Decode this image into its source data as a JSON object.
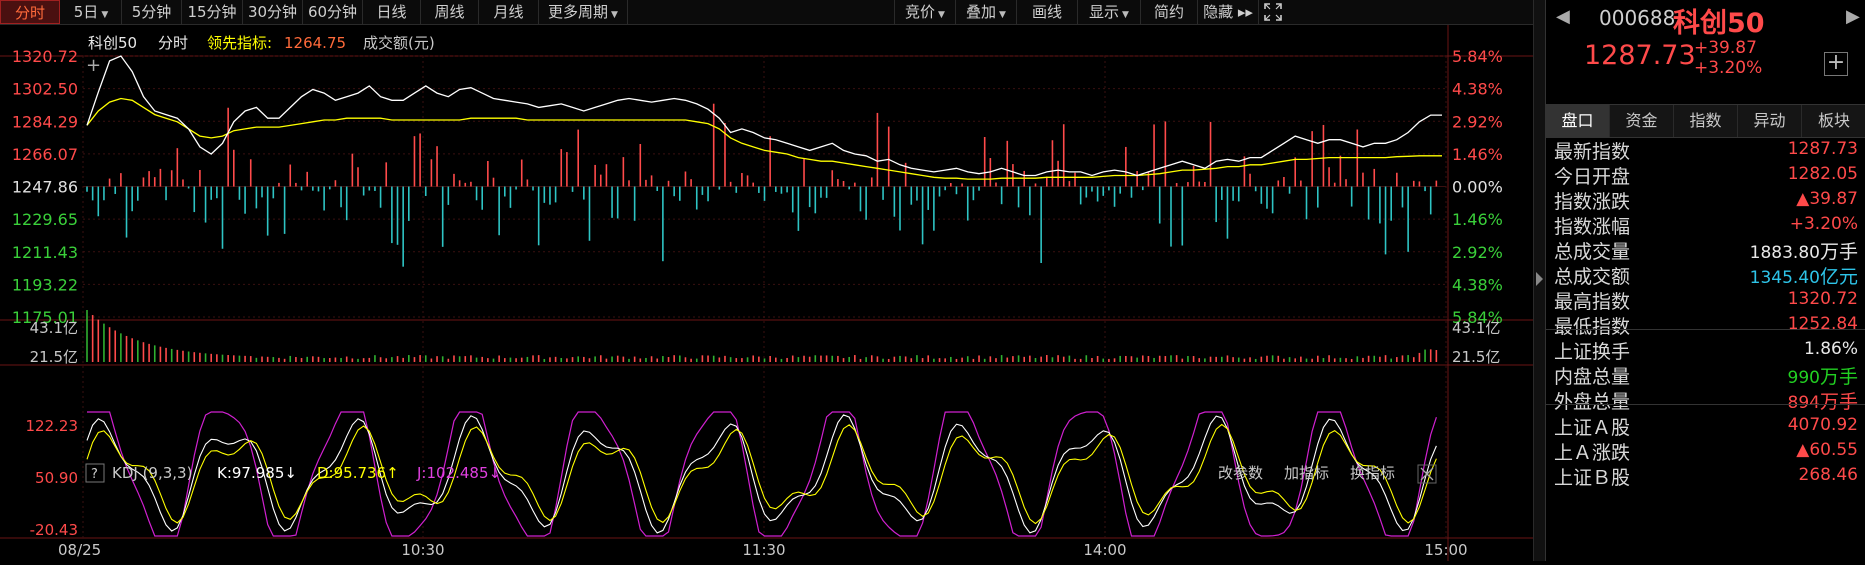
{
  "toolbar": {
    "tabs": [
      {
        "label": "分时",
        "active": true
      },
      {
        "label": "5日",
        "caret": true
      },
      {
        "label": "5分钟"
      },
      {
        "label": "15分钟"
      },
      {
        "label": "30分钟"
      },
      {
        "label": "60分钟"
      },
      {
        "label": "日线"
      },
      {
        "label": "周线"
      },
      {
        "label": "月线"
      },
      {
        "label": "更多周期",
        "caret": true
      }
    ],
    "right_buttons": [
      {
        "label": "竞价",
        "caret": true
      },
      {
        "label": "叠加",
        "caret": true
      },
      {
        "label": "画线"
      },
      {
        "label": "显示",
        "caret": true
      },
      {
        "label": "简约"
      },
      {
        "label": "隐藏 ▸▸"
      }
    ],
    "fullscreen_icon": "expand-icon"
  },
  "chart_legend": {
    "name": "科创50",
    "mode": "分时",
    "leading_label": "领先指标:",
    "leading_value": "1264.75",
    "volume_label": "成交额(元)"
  },
  "price_axis": {
    "left": [
      "1320.72",
      "1302.50",
      "1284.29",
      "1266.07",
      "1247.86",
      "1229.65",
      "1211.43",
      "1193.22",
      "1175.01"
    ],
    "right": [
      "5.84%",
      "4.38%",
      "2.92%",
      "1.46%",
      "0.00%",
      "1.46%",
      "2.92%",
      "4.38%",
      "5.84%"
    ]
  },
  "volume_axis": {
    "left": [
      "43.1亿",
      "21.5亿"
    ],
    "right": [
      "43.1亿",
      "21.5亿"
    ]
  },
  "kdj_panel": {
    "help": "?",
    "name": "KDJ (9,3,3)",
    "k": "K:97.985↓",
    "d": "D:95.736↑",
    "j": "J:102.485↓",
    "buttons": [
      "改参数",
      "加指标",
      "换指标"
    ],
    "axis": [
      "122.23",
      "50.90",
      "-20.43"
    ]
  },
  "time_axis": [
    "08/25",
    "10:30",
    "11:30",
    "14:00",
    "15:00"
  ],
  "colors": {
    "up": "#ff4a4a",
    "down": "#2ec4c4",
    "price_line": "#ffffff",
    "avg_line": "#ffff00",
    "j_line": "#d020d0",
    "accent": "#ff6a3a"
  },
  "chart_data": {
    "type": "line",
    "title": "科创50 分时",
    "x_range": [
      "09:30",
      "15:00"
    ],
    "ylim": [
      1175.01,
      1320.72
    ],
    "base_price": 1247.86,
    "series": [
      {
        "name": "price",
        "values": [
          1282.05,
          1300.5,
          1318.0,
          1320.72,
          1312.0,
          1298.0,
          1290.0,
          1288.0,
          1286.0,
          1280.0,
          1270.0,
          1266.0,
          1272.0,
          1284.0,
          1290.0,
          1292.0,
          1286.0,
          1286.0,
          1292.0,
          1298.0,
          1302.0,
          1300.0,
          1296.0,
          1298.0,
          1300.0,
          1304.0,
          1298.0,
          1296.0,
          1296.0,
          1300.0,
          1304.0,
          1300.0,
          1298.0,
          1302.0,
          1303.0,
          1300.0,
          1297.0,
          1296.0,
          1295.0,
          1294.0,
          1292.0,
          1293.0,
          1294.0,
          1292.0,
          1290.0,
          1292.0,
          1294.0,
          1296.0,
          1297.0,
          1296.0,
          1295.0,
          1296.0,
          1297.0,
          1296.0,
          1294.0,
          1291.0,
          1286.0,
          1278.0,
          1280.0,
          1278.0,
          1275.0,
          1274.0,
          1272.0,
          1270.0,
          1268.0,
          1270.0,
          1272.0,
          1268.0,
          1266.0,
          1265.0,
          1262.0,
          1263.0,
          1260.0,
          1258.0,
          1257.0,
          1256.0,
          1257.0,
          1258.0,
          1256.0,
          1255.0,
          1256.0,
          1258.0,
          1256.0,
          1254.0,
          1254.0,
          1256.0,
          1257.0,
          1256.0,
          1256.0,
          1254.0,
          1256.0,
          1257.0,
          1256.0,
          1254.0,
          1256.0,
          1258.0,
          1260.0,
          1262.0,
          1260.0,
          1258.0,
          1262.0,
          1263.0,
          1262.0,
          1264.0,
          1264.0,
          1268.0,
          1272.0,
          1276.0,
          1274.0,
          1272.0,
          1274.0,
          1274.0,
          1272.0,
          1270.0,
          1272.0,
          1272.0,
          1274.0,
          1278.0,
          1284.0,
          1287.73,
          1287.73
        ]
      },
      {
        "name": "avg",
        "values": [
          1282.05,
          1290.0,
          1295.0,
          1297.0,
          1296.0,
          1292.0,
          1288.0,
          1286.0,
          1284.0,
          1280.0,
          1276.0,
          1275.0,
          1276.0,
          1279.0,
          1280.0,
          1281.0,
          1281.0,
          1281.0,
          1282.0,
          1283.0,
          1284.0,
          1285.0,
          1285.0,
          1286.0,
          1286.0,
          1286.0,
          1286.0,
          1285.0,
          1285.0,
          1285.0,
          1285.0,
          1285.0,
          1285.0,
          1285.0,
          1286.0,
          1286.0,
          1286.0,
          1286.0,
          1286.0,
          1285.0,
          1285.0,
          1285.0,
          1285.0,
          1285.0,
          1285.0,
          1285.0,
          1285.0,
          1285.0,
          1285.0,
          1285.0,
          1285.0,
          1285.0,
          1285.0,
          1285.0,
          1284.0,
          1283.0,
          1280.0,
          1275.0,
          1272.0,
          1270.0,
          1268.0,
          1267.0,
          1266.0,
          1264.0,
          1263.0,
          1262.0,
          1262.0,
          1261.0,
          1260.0,
          1259.0,
          1258.0,
          1257.0,
          1256.0,
          1255.0,
          1254.0,
          1253.0,
          1252.5,
          1252.5,
          1252.0,
          1252.0,
          1252.0,
          1252.5,
          1252.5,
          1252.5,
          1252.5,
          1253.0,
          1253.0,
          1253.0,
          1253.0,
          1253.0,
          1253.5,
          1254.0,
          1254.0,
          1254.0,
          1254.5,
          1255.0,
          1256.0,
          1257.0,
          1257.0,
          1257.5,
          1258.0,
          1259.0,
          1259.0,
          1260.0,
          1260.0,
          1261.0,
          1262.0,
          1263.0,
          1263.0,
          1263.5,
          1264.0,
          1264.0,
          1264.0,
          1264.0,
          1264.0,
          1264.0,
          1264.5,
          1264.75,
          1265.0,
          1265.0,
          1265.0
        ]
      }
    ]
  },
  "sidebar": {
    "code": "000688",
    "name": "科创50",
    "price": "1287.73",
    "change": "+39.87",
    "change_pct": "+3.20%",
    "tabs": [
      "盘口",
      "资金",
      "指数",
      "异动",
      "板块"
    ],
    "rows": [
      {
        "label": "最新指数",
        "value": "1287.73",
        "color": "#ff4a4a"
      },
      {
        "label": "今日开盘",
        "value": "1282.05",
        "color": "#ff4a4a"
      },
      {
        "label": "指数涨跌",
        "value": "▲39.87",
        "color": "#ff4a4a"
      },
      {
        "label": "指数涨幅",
        "value": "+3.20%",
        "color": "#ff4a4a"
      },
      {
        "label": "总成交量",
        "value": "1883.80",
        "unit": "万手",
        "color": "#e8e8e8"
      },
      {
        "label": "总成交额",
        "value": "1345.40",
        "unit": "亿元",
        "color": "#2ec4e8"
      },
      {
        "label": "最高指数",
        "value": "1320.72",
        "color": "#ff4a4a"
      },
      {
        "label": "最低指数",
        "value": "1252.84",
        "color": "#ff4a4a"
      },
      {
        "label": "上证换手",
        "value": "1.86%",
        "color": "#e8e8e8"
      },
      {
        "label": "内盘总量",
        "value": "990",
        "unit": "万手",
        "color": "#22d022"
      },
      {
        "label": "外盘总量",
        "value": "894",
        "unit": "万手",
        "color": "#ff4a4a"
      },
      {
        "label": "上证Ａ股",
        "value": "4070.92",
        "color": "#ff4a4a"
      },
      {
        "label": "上Ａ涨跌",
        "value": "▲60.55",
        "color": "#ff4a4a"
      },
      {
        "label": "上证Ｂ股",
        "value": "268.46",
        "color": "#ff4a4a"
      }
    ]
  }
}
